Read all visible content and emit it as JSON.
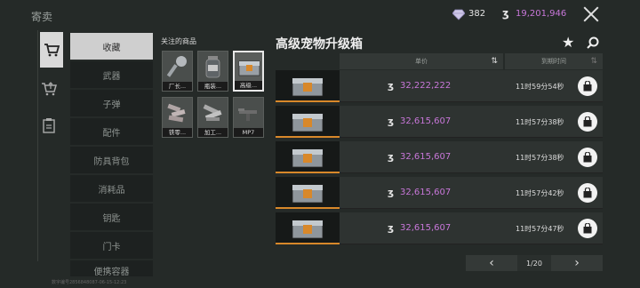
{
  "header": {
    "title": "寄卖",
    "gems": "382",
    "money": "19,201,946",
    "coin_symbol": "ʒ"
  },
  "side_tabs": [
    "cart-icon",
    "cart-up-icon",
    "clipboard-icon"
  ],
  "categories": [
    {
      "label": "收藏",
      "active": true
    },
    {
      "label": "武器"
    },
    {
      "label": "子弹"
    },
    {
      "label": "配件"
    },
    {
      "label": "防具背包"
    },
    {
      "label": "消耗品"
    },
    {
      "label": "钥匙"
    },
    {
      "label": "门卡"
    },
    {
      "label": "便携容器"
    }
  ],
  "favorites": {
    "title": "关注的商品",
    "items": [
      {
        "label": "厂长...",
        "icon": "key-icon"
      },
      {
        "label": "瓶装...",
        "icon": "jar-icon"
      },
      {
        "label": "高级...",
        "icon": "chest-icon",
        "selected": true
      },
      {
        "label": "铁零...",
        "icon": "iron-parts-icon"
      },
      {
        "label": "加工...",
        "icon": "processed-parts-icon"
      },
      {
        "label": "MP7",
        "icon": "gun-icon"
      }
    ]
  },
  "panel": {
    "title": "高级宠物升级箱",
    "col_price": "单价",
    "col_time": "到期时间",
    "rows": [
      {
        "price": "32,222,222",
        "time": "11时59分54秒"
      },
      {
        "price": "32,615,607",
        "time": "11时57分38秒"
      },
      {
        "price": "32,615,607",
        "time": "11时57分38秒"
      },
      {
        "price": "32,615,607",
        "time": "11时57分42秒"
      },
      {
        "price": "32,615,607",
        "time": "11时57分47秒"
      }
    ]
  },
  "pager": {
    "label": "1/20",
    "prev": "‹",
    "next": "›"
  },
  "footer": "数字编号2856848087-06-15-12:23",
  "colors": {
    "accent_price": "#c877d9",
    "rarity_border": "#d8882a"
  }
}
